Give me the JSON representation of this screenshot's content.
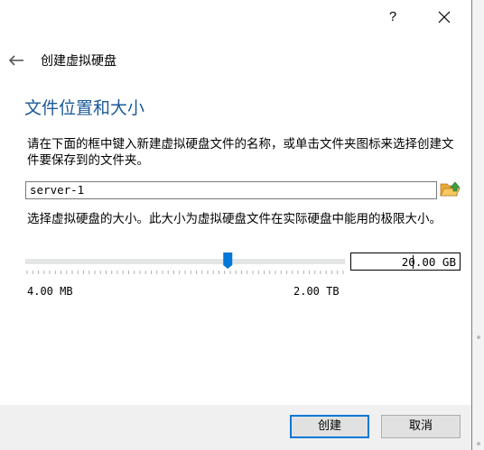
{
  "titlebar": {
    "help_label": "?",
    "close_icon": "close-icon"
  },
  "header": {
    "back_icon": "back-arrow-icon",
    "wizard_title": "创建虚拟硬盘"
  },
  "location": {
    "section_title": "文件位置和大小",
    "description": "请在下面的框中键入新建虚拟硬盘文件的名称，或单击文件夹图标来选择创建文件要保存到的文件夹。",
    "file_name_value": "server-1",
    "folder_icon": "folder-open-icon"
  },
  "size": {
    "description": "选择虚拟硬盘的大小。此大小为虚拟硬盘文件在实际硬盘中能用的极限大小。",
    "slider_fraction": 0.635,
    "value": "20.00 GB",
    "min_label": "4.00 MB",
    "max_label": "2.00 TB"
  },
  "buttons": {
    "create_label": "创建",
    "cancel_label": "取消"
  },
  "colors": {
    "accent": "#0078d7",
    "section_title": "#1c5a99",
    "folder": "#e8a93a"
  }
}
